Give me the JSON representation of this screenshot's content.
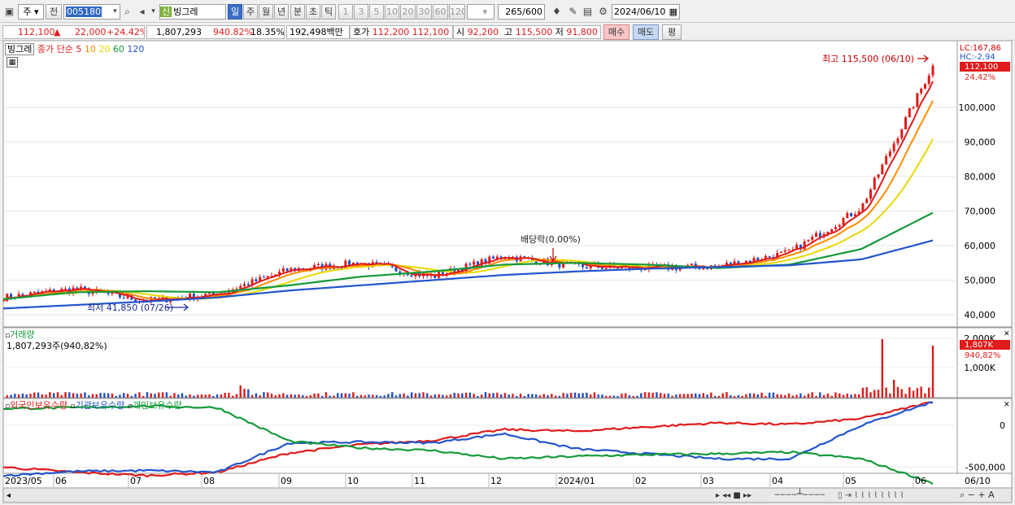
{
  "toolbar": {
    "period": "주",
    "prev": "전",
    "code": "005180",
    "name": "빙그레",
    "badge": "신",
    "periods": [
      "일",
      "주",
      "월",
      "년",
      "분",
      "초",
      "틱"
    ],
    "ticks": [
      "1",
      "3",
      "5",
      "10",
      "20",
      "30",
      "60",
      "120"
    ],
    "count": "265",
    "count_max": "/600",
    "date": "2024/06/10"
  },
  "quote": {
    "price": "112,100",
    "up_mark": "▲",
    "change": "22,000",
    "change_pct": "+24.42%",
    "volume": "1,807,293",
    "vol_ratio": "940.82%",
    "turnover": "18.35%",
    "amount": "192,498백만",
    "bid_label": "호가",
    "bid": "112,200",
    "ask": "112,100",
    "open_label": "시",
    "open": "92,200",
    "high_label": "고",
    "high": "115,500",
    "low_label": "저",
    "low": "91,800",
    "buy": "매수",
    "sell": "매도",
    "flat": "평"
  },
  "price_panel": {
    "name": "빙그레",
    "ma_label": "종가 단순",
    "ma_periods": [
      "5",
      "10",
      "20",
      "60",
      "120"
    ],
    "ma_colors": [
      "#e01b1b",
      "#ff8c00",
      "#e8d800",
      "#159a3a",
      "#2255cc"
    ],
    "max_note": "최고 115,500 (06/10)",
    "min_note": "최저 41,850 (07/26)",
    "div_note": "배당락(0.00%)",
    "lc": "LC:167,86",
    "hc": "HC:-2,94",
    "last_price": "112,100",
    "last_pct": "24,42%",
    "y_ticks": [
      "100,000",
      "90,000",
      "80,000",
      "70,000",
      "60,000",
      "50,000",
      "40,000"
    ]
  },
  "volume_panel": {
    "name": "거래량",
    "value": "1,807,293주(940,82%)",
    "y_ticks": [
      "2,000K",
      "1,000K"
    ],
    "last": "1,807K",
    "last_pct": "940,82%"
  },
  "holding_panel": {
    "series": [
      "외국인보유수량",
      "기관보유수량",
      "개인보유수량"
    ],
    "colors": [
      "#e01b1b",
      "#2255cc",
      "#159a3a"
    ],
    "y_ticks": [
      "0",
      "-500,000"
    ]
  },
  "x_labels": [
    "2023/05",
    "06",
    "07",
    "08",
    "09",
    "10",
    "11",
    "12",
    "2024/01",
    "02",
    "03",
    "04",
    "05",
    "06"
  ],
  "x_last": "06/10",
  "chart_data": {
    "type": "line",
    "x": [
      "2023/05",
      "2023/06",
      "2023/07",
      "2023/08",
      "2023/09",
      "2023/10",
      "2023/11",
      "2023/12",
      "2024/01",
      "2024/02",
      "2024/03",
      "2024/04",
      "2024/05",
      "2024/06"
    ],
    "series": [
      {
        "name": "종가",
        "values": [
          45000,
          47500,
          44000,
          46000,
          53000,
          55000,
          51000,
          57000,
          54000,
          53500,
          54000,
          58000,
          71000,
          112100
        ]
      },
      {
        "name": "60",
        "values": [
          44500,
          46500,
          46800,
          46500,
          48500,
          51000,
          52500,
          54500,
          55000,
          54500,
          53500,
          54500,
          59000,
          69500
        ]
      },
      {
        "name": "120",
        "values": [
          41800,
          42800,
          43800,
          45000,
          47000,
          48500,
          50000,
          51500,
          52500,
          53300,
          53800,
          54300,
          56000,
          61500
        ]
      },
      {
        "name": "외국인보유수량",
        "values": [
          -500000,
          -560000,
          -600000,
          -560000,
          -330000,
          -230000,
          -180000,
          -50000,
          -70000,
          -20000,
          30000,
          10000,
          80000,
          280000
        ]
      },
      {
        "name": "기관보유수량",
        "values": [
          -600000,
          -550000,
          -540000,
          -560000,
          -210000,
          -200000,
          -210000,
          -100000,
          -280000,
          -340000,
          -400000,
          -400000,
          0,
          280000
        ]
      },
      {
        "name": "개인보유수량",
        "values": [
          200000,
          210000,
          230000,
          210000,
          -190000,
          -270000,
          -300000,
          -400000,
          -370000,
          -350000,
          -340000,
          -320000,
          -400000,
          -690000
        ]
      }
    ],
    "volume": {
      "value": 1807293,
      "unit": "주"
    },
    "ylim": [
      37000,
      120000
    ]
  }
}
